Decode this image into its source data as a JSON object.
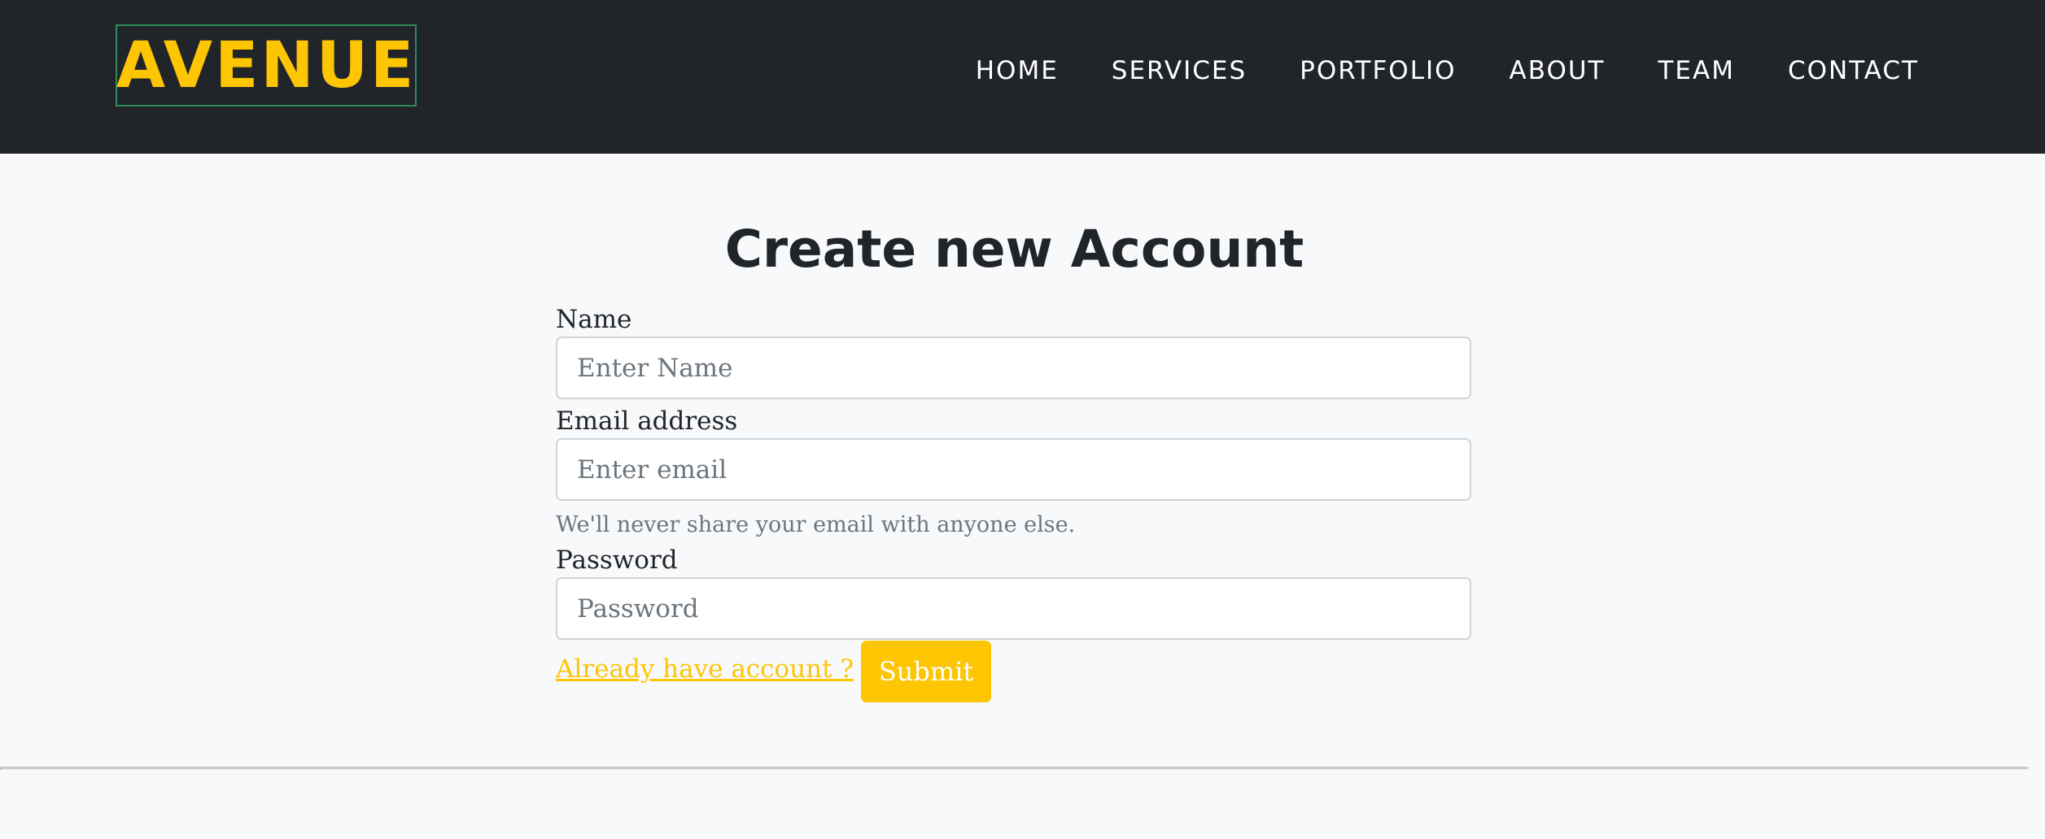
{
  "navbar": {
    "brand": "AVENUE",
    "links": [
      "HOME",
      "SERVICES",
      "PORTFOLIO",
      "ABOUT",
      "TEAM",
      "CONTACT"
    ]
  },
  "form": {
    "title": "Create new Account",
    "name": {
      "label": "Name",
      "placeholder": "Enter Name",
      "value": ""
    },
    "email": {
      "label": "Email address",
      "placeholder": "Enter email",
      "value": "",
      "help": "We'll never share your email with anyone else."
    },
    "password": {
      "label": "Password",
      "placeholder": "Password",
      "value": ""
    },
    "login_link": "Already have account ?",
    "submit_label": "Submit"
  },
  "colors": {
    "navbar_bg": "#212529",
    "accent": "#fec503",
    "page_bg": "#f8f9fa"
  }
}
